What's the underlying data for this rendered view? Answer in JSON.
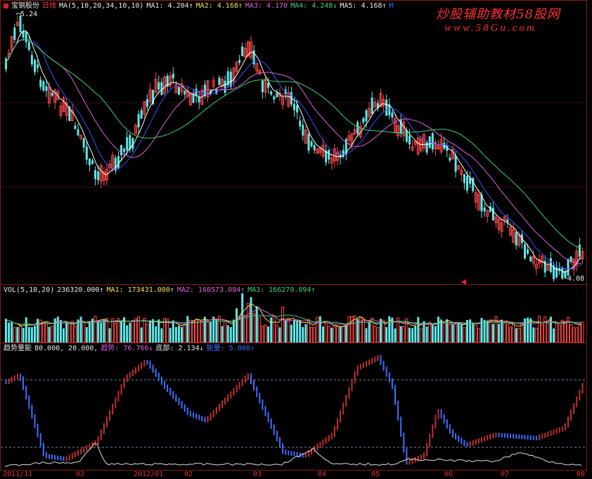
{
  "stock": {
    "name": "宝钢股份",
    "period": "日线"
  },
  "price_header": {
    "params": "MA(5,10,20,34,10,10)",
    "ma1": "MA1: 4.204↑",
    "ma2": "MA2: 4.168↑",
    "ma3": "MA3: 4.170",
    "ma4": "MA4: 4.248↓",
    "ma5": "MA5: 4.168↑",
    "ma6": "M"
  },
  "price_labels": {
    "high": "5.24",
    "low": "4.08"
  },
  "vol_header": {
    "params": "VOL(5,10,20)",
    "vol": "236320.000↑",
    "ma1": "MA1: 173431.000↑",
    "ma2": "MA2: 160573.094↑",
    "ma3": "MA3: 166279.094↑"
  },
  "ind_header": {
    "name": "趋势量能",
    "params": "80.000, 20.000,",
    "trend": "趋势: 76.766↓",
    "bottom": "底部: 2.134↓",
    "extra": "能量: 5.008↑"
  },
  "dates": [
    "2011/11",
    "02",
    "2012/01",
    "02",
    "03",
    "04",
    "05",
    "06",
    "07",
    "08"
  ],
  "watermark": {
    "main": "炒股辅助教材58股网",
    "url": "www.58Gu.com"
  },
  "colors": {
    "up": "#ff4848",
    "down": "#5fe8e8",
    "ind_up": "#c03030",
    "ind_down": "#3b6fff",
    "ma1": "#ffffff",
    "ma2": "#3b4fff",
    "ma3": "#e060e0",
    "ma4": "#39d27a"
  },
  "icons": {
    "ticker": "ticker-square-icon"
  }
}
